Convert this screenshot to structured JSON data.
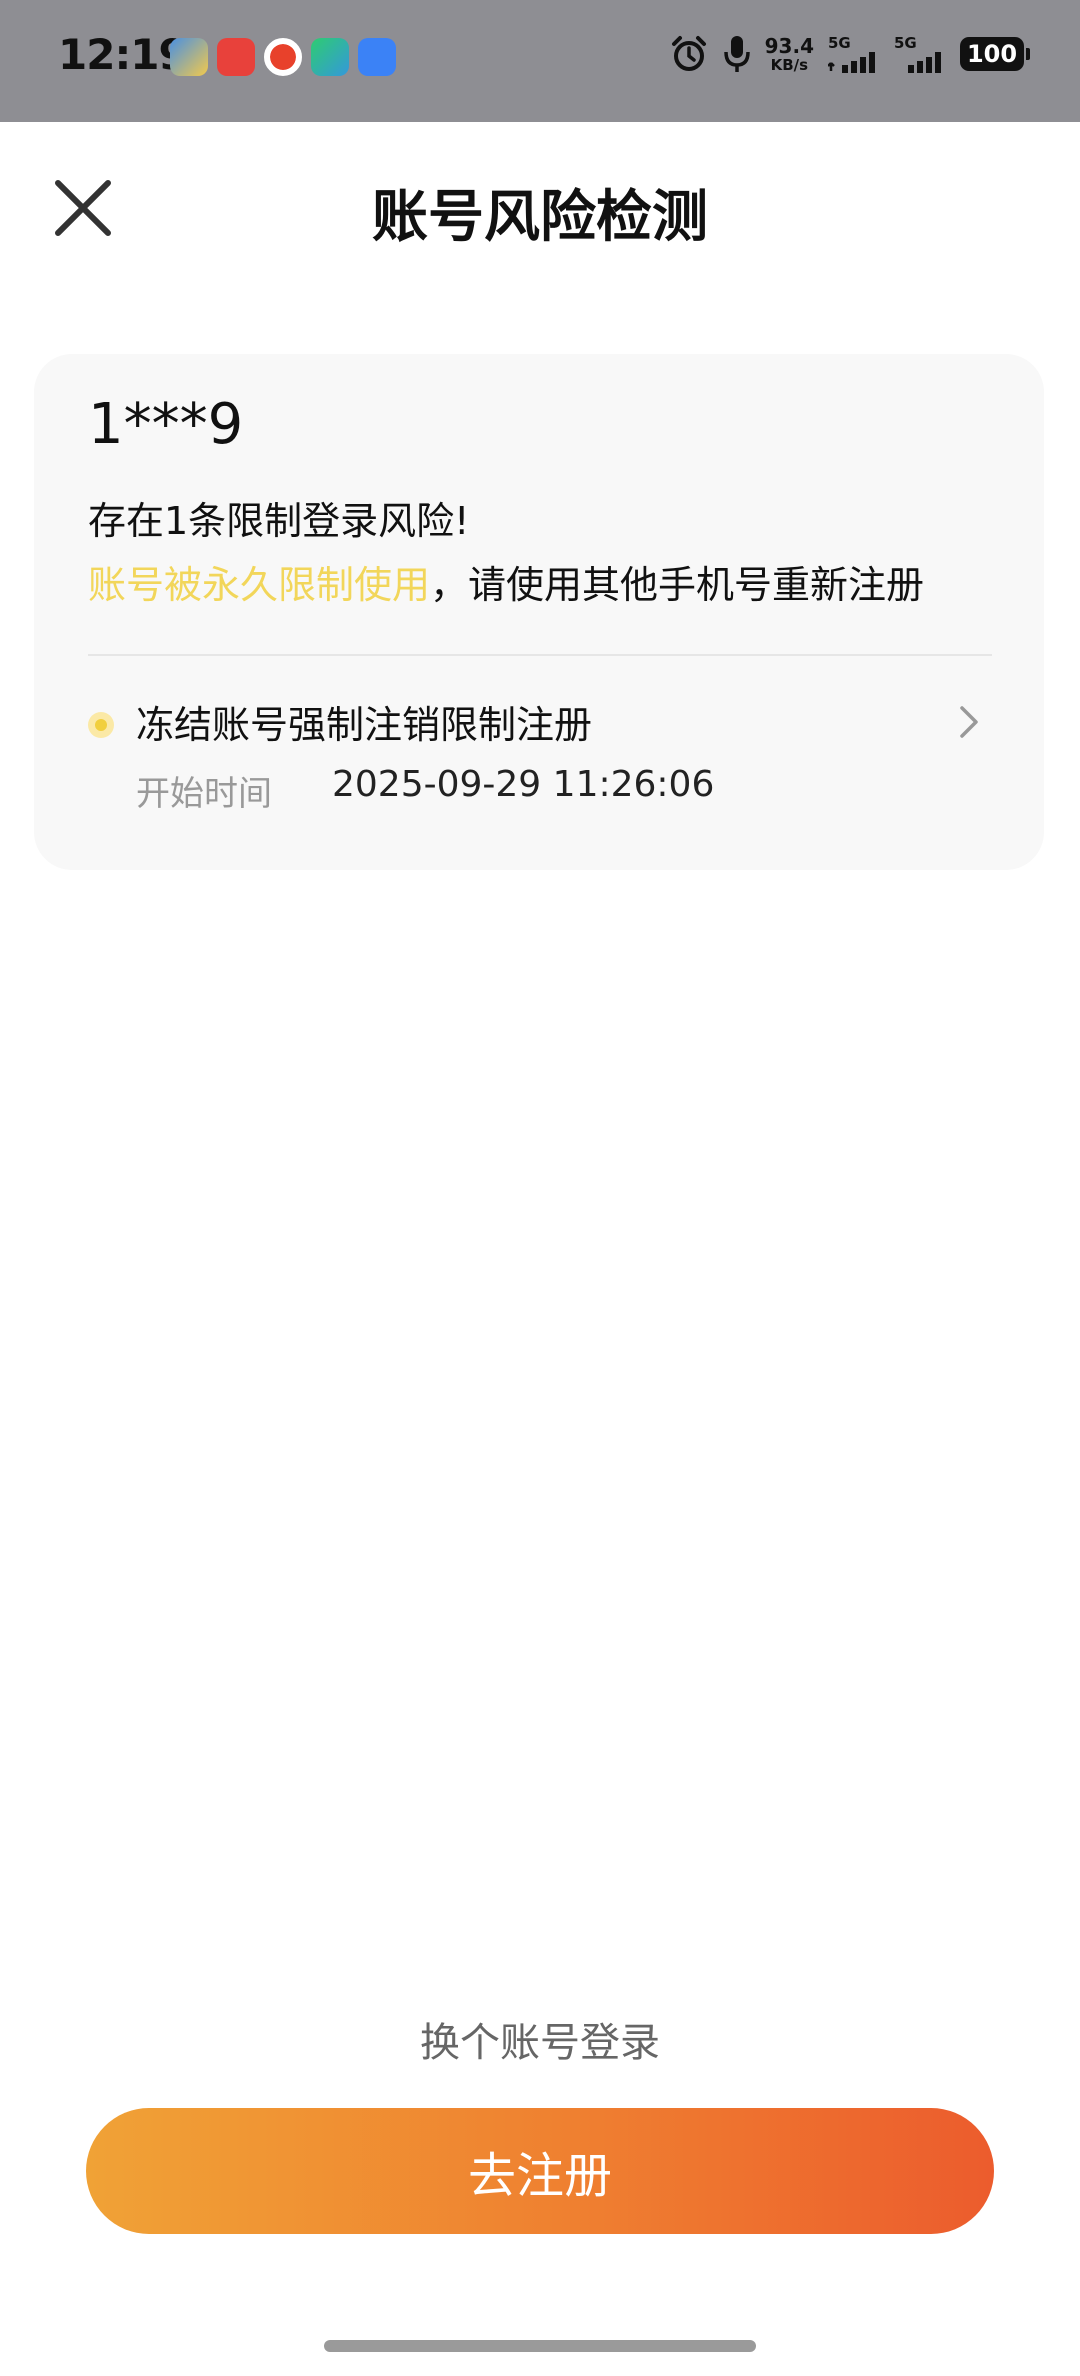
{
  "status_bar": {
    "time": "12:19",
    "net_speed_value": "93.4",
    "net_speed_unit": "KB/s",
    "signal1_label": "5G",
    "signal2_label": "5G",
    "battery": "100"
  },
  "header": {
    "title": "账号风险检测",
    "close_icon": "close-icon"
  },
  "card": {
    "account": "1***9",
    "risk_count_text": "存在1条限制登录风险!",
    "risk_highlight": "账号被永久限制使用",
    "risk_suffix": "，请使用其他手机号重新注册",
    "item": {
      "title": "冻结账号强制注销限制注册",
      "time_label": "开始时间",
      "time_value": "2025-09-29 11:26:06"
    }
  },
  "footer": {
    "switch_account": "换个账号登录",
    "register_button": "去注册"
  },
  "colors": {
    "highlight": "#f2d65a",
    "button_start": "#f0a236",
    "button_end": "#ec5c2d"
  }
}
